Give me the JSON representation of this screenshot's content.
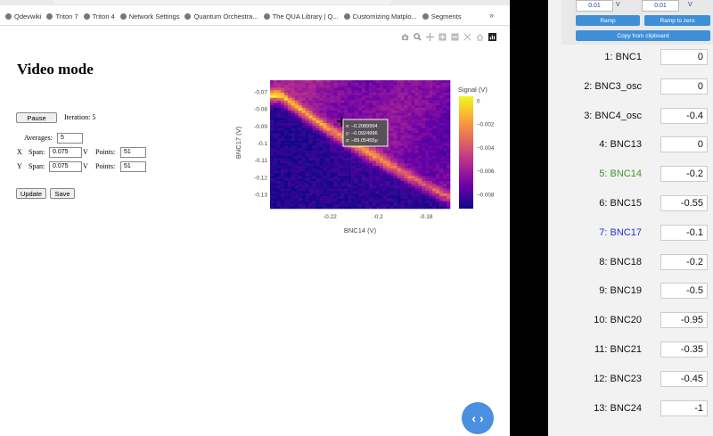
{
  "browser": {
    "bookmarks": [
      "Qdevwiki",
      "Triton 7",
      "Triton 4",
      "Network Settings",
      "Quantum Orchestra...",
      "The QUA Library | Q...",
      "Customizing Matplo...",
      "Segments"
    ],
    "more": "»"
  },
  "page": {
    "title": "Video mode",
    "pause_label": "Pause",
    "iteration_label": "Iteration: 5",
    "averages_label": "Averages:",
    "averages_value": "5",
    "x_label": "X",
    "y_label": "Y",
    "span_label": "Span:",
    "unit_v": "V",
    "points_label": "Points:",
    "x_span": "0.075",
    "x_points": "51",
    "y_span": "0.075",
    "y_points": "51",
    "update_label": "Update",
    "save_label": "Save",
    "fab_icon": "code-icon",
    "fab_glyph": "‹ ›"
  },
  "chart_data": {
    "type": "heatmap",
    "xlabel": "BNC14 (V)",
    "ylabel": "BNC17 (V)",
    "xlim": [
      -0.245,
      -0.17
    ],
    "ylim": [
      -0.138,
      -0.063
    ],
    "xticks": [
      "-0.22",
      "-0.2",
      "-0.18"
    ],
    "xtick_values": [
      -0.22,
      -0.2,
      -0.18
    ],
    "yticks": [
      "-0.07",
      "-0.08",
      "-0.09",
      "-0.1",
      "-0.11",
      "-0.12",
      "-0.13"
    ],
    "ytick_values": [
      -0.07,
      -0.08,
      -0.09,
      -0.1,
      -0.11,
      -0.12,
      -0.13
    ],
    "colorbar_title": "Signal (V)",
    "colorbar_ticks": [
      "0",
      "−0.002",
      "−0.004",
      "−0.006",
      "−0.008"
    ],
    "colorbar_values": [
      0,
      -0.002,
      -0.004,
      -0.006,
      -0.008
    ],
    "zlim": [
      -0.0092,
      0.0004
    ],
    "colorscale": [
      "#0d0887",
      "#6a00a8",
      "#b12a90",
      "#e16462",
      "#fca636",
      "#f0f921"
    ],
    "hover": {
      "x": "x: −0.2089994",
      "y": "y: −0.0924996",
      "z": "z: −89.05455μ"
    }
  },
  "panel": {
    "top_inputs": [
      "0.01",
      "0.01"
    ],
    "top_units": [
      "V",
      "V"
    ],
    "ramp_label": "Ramp",
    "ramp_zero_label": "Ramp to zero",
    "copy_label": "Copy from clipboard",
    "unit": "V",
    "rows": [
      {
        "name": "1: BNC1",
        "value": "0",
        "color": "#111111"
      },
      {
        "name": "2: BNC3_osc",
        "value": "0",
        "color": "#111111"
      },
      {
        "name": "3: BNC4_osc",
        "value": "-0.4",
        "color": "#111111"
      },
      {
        "name": "4: BNC13",
        "value": "0",
        "color": "#111111"
      },
      {
        "name": "5: BNC14",
        "value": "-0.2",
        "color": "#3a9a28"
      },
      {
        "name": "6: BNC15",
        "value": "-0.55",
        "color": "#111111"
      },
      {
        "name": "7: BNC17",
        "value": "-0.1",
        "color": "#2233cc"
      },
      {
        "name": "8: BNC18",
        "value": "-0.2",
        "color": "#111111"
      },
      {
        "name": "9: BNC19",
        "value": "-0.5",
        "color": "#111111"
      },
      {
        "name": "10: BNC20",
        "value": "-0.95",
        "color": "#111111"
      },
      {
        "name": "11: BNC21",
        "value": "-0.35",
        "color": "#111111"
      },
      {
        "name": "12: BNC23",
        "value": "-0.45",
        "color": "#111111"
      },
      {
        "name": "13: BNC24",
        "value": "-1",
        "color": "#111111"
      }
    ]
  }
}
